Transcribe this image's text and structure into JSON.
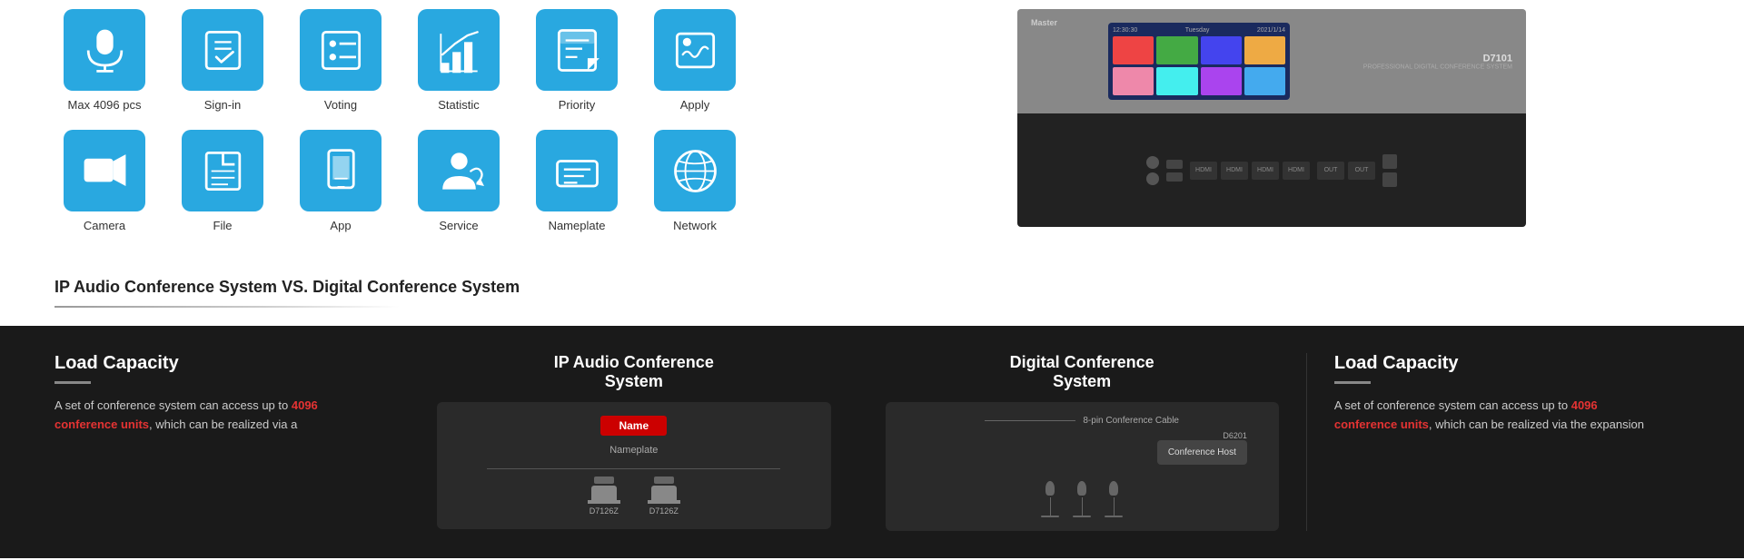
{
  "features": {
    "row1": [
      {
        "id": "max4096",
        "label": "Max 4096 pcs",
        "icon": "mic"
      },
      {
        "id": "signin",
        "label": "Sign-in",
        "icon": "signin"
      },
      {
        "id": "voting",
        "label": "Voting",
        "icon": "voting"
      },
      {
        "id": "statistic",
        "label": "Statistic",
        "icon": "statistic"
      },
      {
        "id": "priority",
        "label": "Priority",
        "icon": "priority"
      },
      {
        "id": "apply",
        "label": "Apply",
        "icon": "apply"
      }
    ],
    "row2": [
      {
        "id": "camera",
        "label": "Camera",
        "icon": "camera"
      },
      {
        "id": "file",
        "label": "File",
        "icon": "file"
      },
      {
        "id": "app",
        "label": "App",
        "icon": "app"
      },
      {
        "id": "service",
        "label": "Service",
        "icon": "service"
      },
      {
        "id": "nameplate",
        "label": "Nameplate",
        "icon": "nameplate"
      },
      {
        "id": "network",
        "label": "Network",
        "icon": "network"
      }
    ]
  },
  "product": {
    "model": "D7101",
    "description": "PROFESSIONAL DIGITAL CONFERENCE SYSTEM"
  },
  "comparison": {
    "title": "IP Audio Conference System VS. Digital Conference System"
  },
  "sections": {
    "left": {
      "title": "Load Capacity",
      "text_before": "A set of conference system can access up to ",
      "highlight": "4096 conference units",
      "text_after": ", which can be realized via a"
    },
    "ip_diagram": {
      "title": "IP Audio Conference",
      "subtitle": "System",
      "nameplate_label": "Name",
      "device_label": "Nameplate",
      "mic_label1": "D7126Z",
      "mic_label2": "D7126Z"
    },
    "digital_diagram": {
      "title": "Digital Conference",
      "subtitle": "System",
      "cable_label": "8-pin Conference Cable",
      "host_model": "D6201",
      "host_name": "Conference Host",
      "mic_count": 3
    },
    "right": {
      "title": "Load Capacity",
      "text_before": "A set of conference system can access up to ",
      "highlight": "4096 conference units",
      "text_after": ", which can be realized via the expansion"
    }
  }
}
